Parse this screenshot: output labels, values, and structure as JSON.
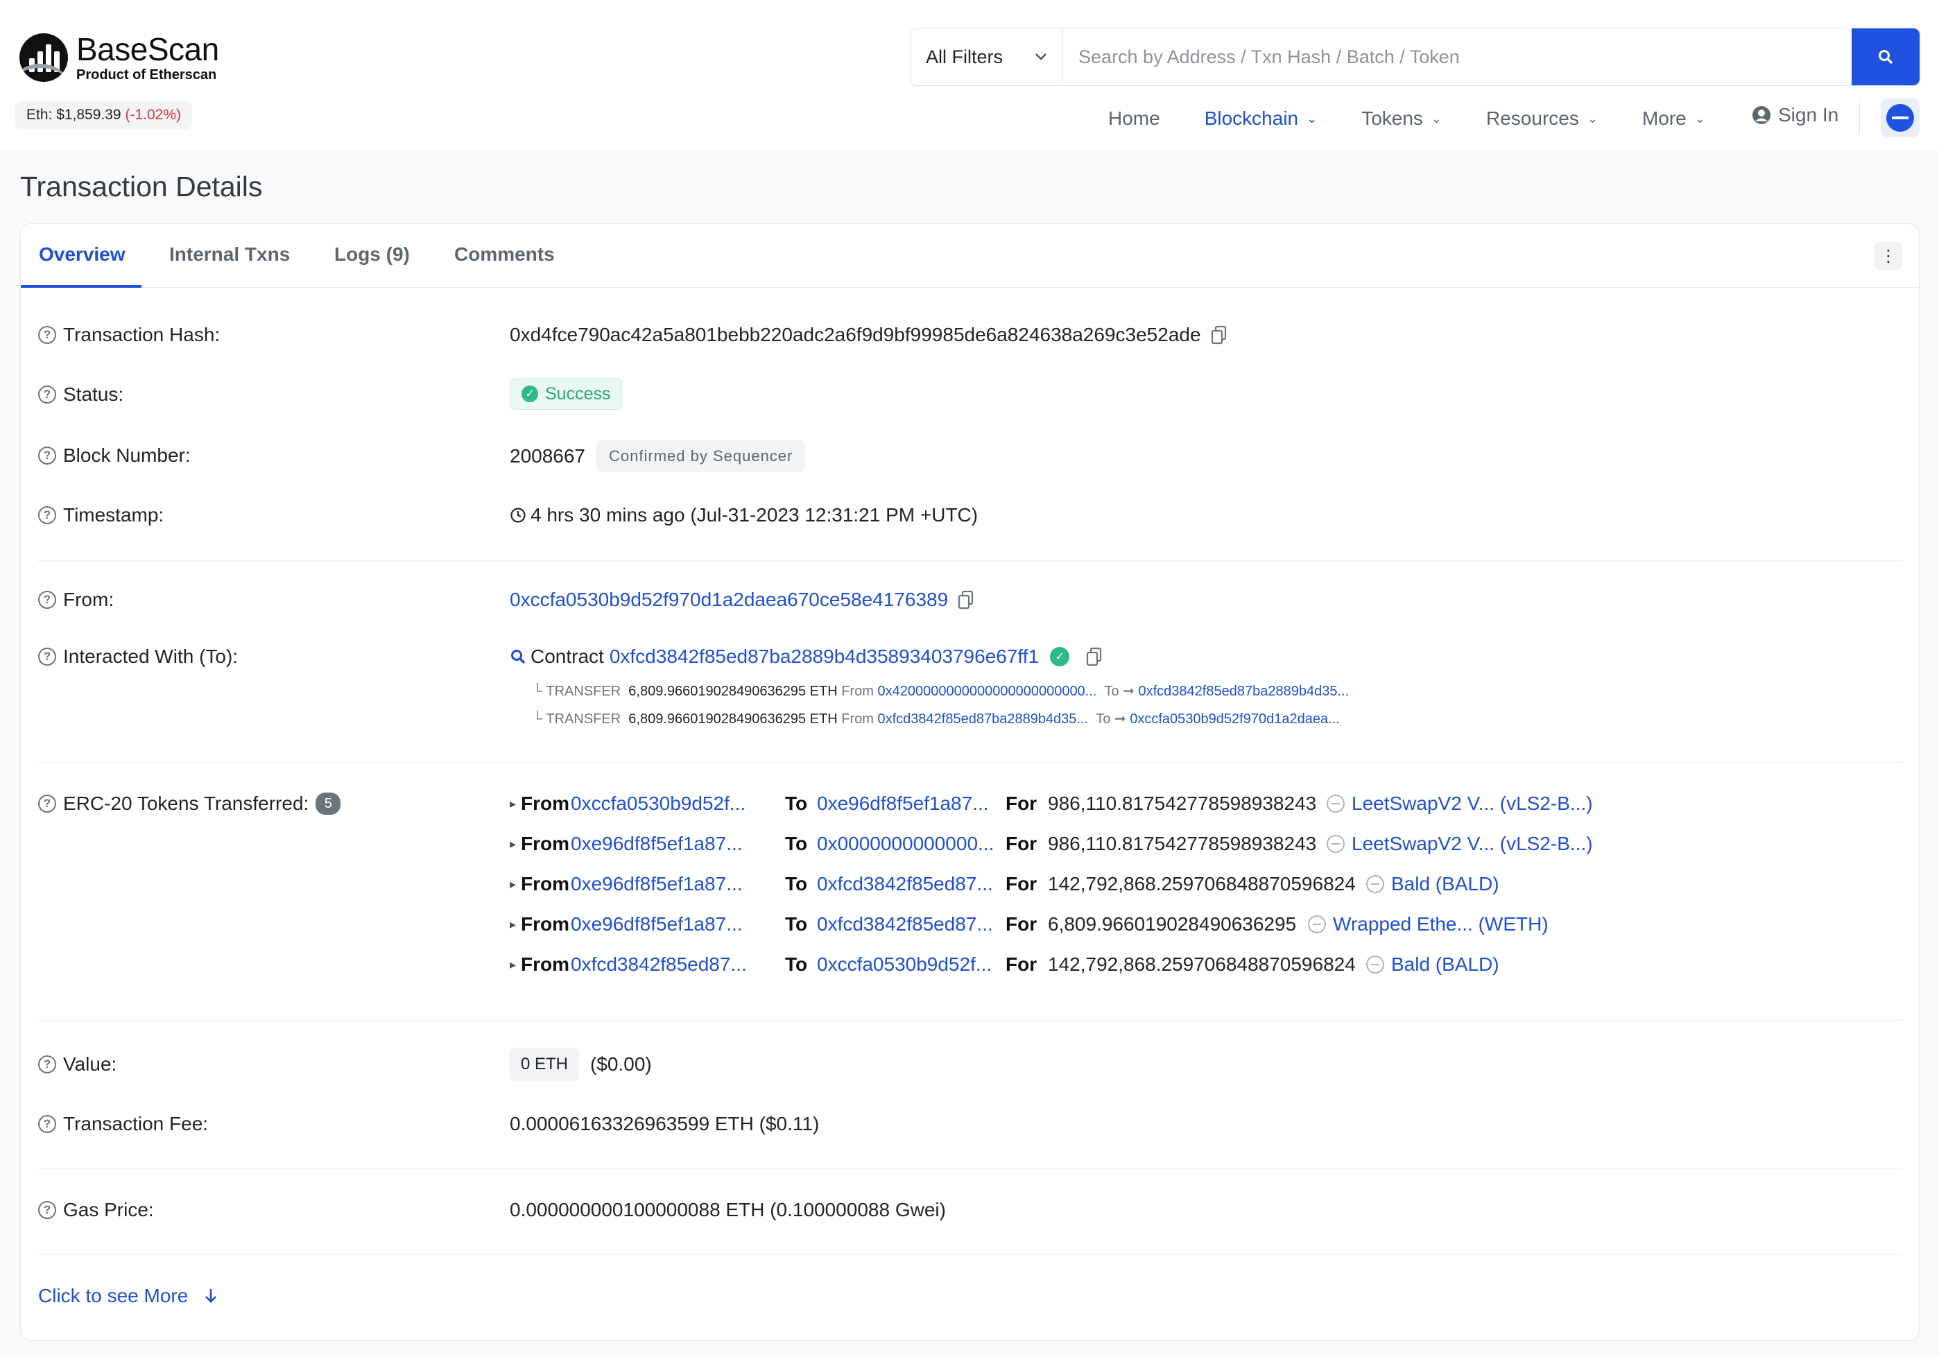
{
  "header": {
    "logo_title": "BaseScan",
    "logo_sub": "Product of Etherscan",
    "price_label": "Eth: $1,859.39",
    "price_change": "(-1.02%)",
    "filter_label": "All Filters",
    "search_placeholder": "Search by Address / Txn Hash / Batch / Token",
    "nav": [
      "Home",
      "Blockchain",
      "Tokens",
      "Resources",
      "More"
    ],
    "signin": "Sign In"
  },
  "page": {
    "title": "Transaction Details",
    "tabs": [
      "Overview",
      "Internal Txns",
      "Logs (9)",
      "Comments"
    ]
  },
  "details": {
    "hash_label": "Transaction Hash:",
    "hash_value": "0xd4fce790ac42a5a801bebb220adc2a6f9d9bf99985de6a824638a269c3e52ade",
    "status_label": "Status:",
    "status_value": "Success",
    "block_label": "Block Number:",
    "block_value": "2008667",
    "block_note": "Confirmed by Sequencer",
    "timestamp_label": "Timestamp:",
    "timestamp_value": "4 hrs 30 mins ago (Jul-31-2023 12:31:21 PM +UTC)",
    "from_label": "From:",
    "from_value": "0xccfa0530b9d52f970d1a2daea670ce58e4176389",
    "to_label": "Interacted With (To):",
    "to_prefix": "Contract",
    "to_value": "0xfcd3842f85ed87ba2889b4d35893403796e67ff1",
    "transfers": [
      {
        "type": "TRANSFER",
        "amount": "6,809.966019028490636295 ETH",
        "from_word": "From",
        "from": "0x4200000000000000000000000...",
        "to_word": "To",
        "to": "0xfcd3842f85ed87ba2889b4d35..."
      },
      {
        "type": "TRANSFER",
        "amount": "6,809.966019028490636295 ETH",
        "from_word": "From",
        "from": "0xfcd3842f85ed87ba2889b4d35...",
        "to_word": "To",
        "to": "0xccfa0530b9d52f970d1a2daea..."
      }
    ],
    "erc20_label": "ERC-20 Tokens Transferred:",
    "erc20_count": "5",
    "erc20": [
      {
        "from": "0xccfa0530b9d52f...",
        "to": "0xe96df8f5ef1a87...",
        "amount": "986,110.817542778598938243",
        "token": "LeetSwapV2 V... (vLS2-B...)"
      },
      {
        "from": "0xe96df8f5ef1a87...",
        "to": "0x0000000000000...",
        "amount": "986,110.817542778598938243",
        "token": "LeetSwapV2 V... (vLS2-B...)"
      },
      {
        "from": "0xe96df8f5ef1a87...",
        "to": "0xfcd3842f85ed87...",
        "amount": "142,792,868.259706848870596824",
        "token": "Bald (BALD)"
      },
      {
        "from": "0xe96df8f5ef1a87...",
        "to": "0xfcd3842f85ed87...",
        "amount": "6,809.966019028490636295",
        "token": "Wrapped Ethe... (WETH)"
      },
      {
        "from": "0xfcd3842f85ed87...",
        "to": "0xccfa0530b9d52f...",
        "amount": "142,792,868.259706848870596824",
        "token": "Bald (BALD)"
      }
    ],
    "words": {
      "from": "From",
      "to": "To",
      "for": "For"
    },
    "value_label": "Value:",
    "value_pill": "0 ETH",
    "value_usd": "($0.00)",
    "fee_label": "Transaction Fee:",
    "fee_value": "0.00006163326963599 ETH ($0.11)",
    "gas_label": "Gas Price:",
    "gas_value": "0.000000000100000088 ETH (0.100000088 Gwei)",
    "see_more": "Click to see More"
  },
  "colors": {
    "accent": "#1e4fd8",
    "success": "#2fb88a",
    "danger": "#d63939"
  }
}
